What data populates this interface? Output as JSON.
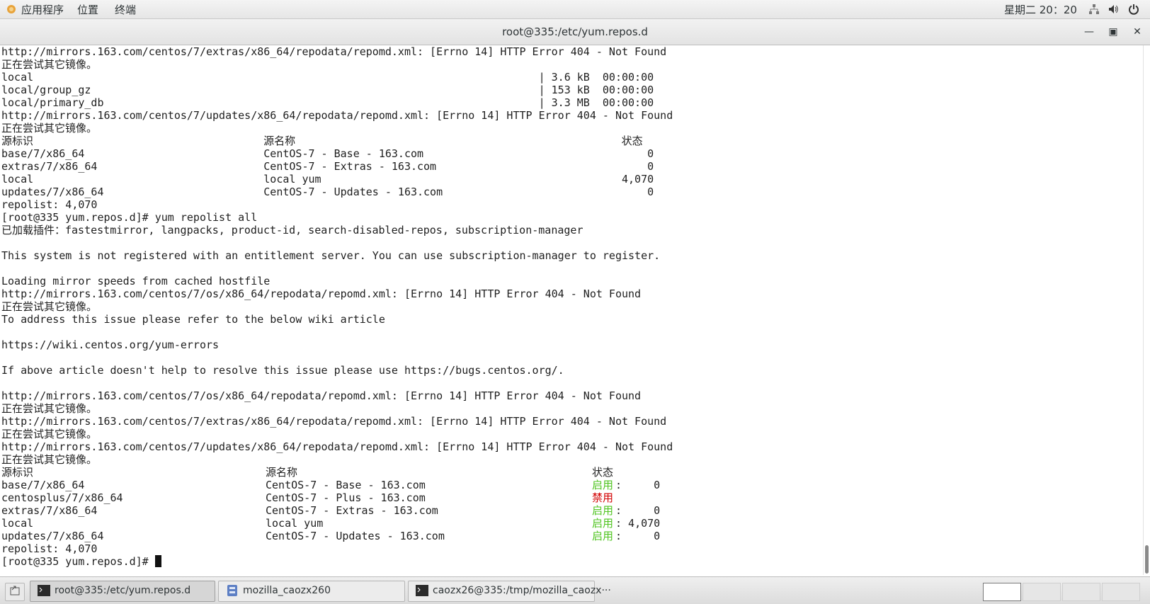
{
  "top_panel": {
    "menus": [
      "应用程序",
      "位置",
      "终端"
    ],
    "clock": "星期二 20：20",
    "icons": [
      "apps-icon",
      "network-icon",
      "volume-icon",
      "power-icon"
    ]
  },
  "window": {
    "title": "root@335:/etc/yum.repos.d",
    "buttons": [
      "minimize",
      "maximize",
      "close"
    ]
  },
  "terminal": {
    "lines": [
      "http://mirrors.163.com/centos/7/extras/x86_64/repodata/repomd.xml: [Errno 14] HTTP Error 404 - Not Found",
      "正在尝试其它镜像。",
      "local                                                                               | 3.6 kB  00:00:00",
      "local/group_gz                                                                      | 153 kB  00:00:00",
      "local/primary_db                                                                    | 3.3 MB  00:00:00",
      "http://mirrors.163.com/centos/7/updates/x86_64/repodata/repomd.xml: [Errno 14] HTTP Error 404 - Not Found",
      "正在尝试其它镜像。",
      "源标识                                    源名称                                                   状态",
      "base/7/x86_64                            CentOS-7 - Base - 163.com                                   0",
      "extras/7/x86_64                          CentOS-7 - Extras - 163.com                                 0",
      "local                                    local yum                                               4,070",
      "updates/7/x86_64                         CentOS-7 - Updates - 163.com                                0",
      "repolist: 4,070",
      "[root@335 yum.repos.d]# yum repolist all",
      "已加载插件：fastestmirror, langpacks, product-id, search-disabled-repos, subscription-manager",
      "",
      "This system is not registered with an entitlement server. You can use subscription-manager to register.",
      "",
      "Loading mirror speeds from cached hostfile",
      "http://mirrors.163.com/centos/7/os/x86_64/repodata/repomd.xml: [Errno 14] HTTP Error 404 - Not Found",
      "正在尝试其它镜像。",
      "To address this issue please refer to the below wiki article",
      "",
      "https://wiki.centos.org/yum-errors",
      "",
      "If above article doesn't help to resolve this issue please use https://bugs.centos.org/.",
      "",
      "http://mirrors.163.com/centos/7/os/x86_64/repodata/repomd.xml: [Errno 14] HTTP Error 404 - Not Found",
      "正在尝试其它镜像。",
      "http://mirrors.163.com/centos/7/extras/x86_64/repodata/repomd.xml: [Errno 14] HTTP Error 404 - Not Found",
      "正在尝试其它镜像。",
      "http://mirrors.163.com/centos/7/updates/x86_64/repodata/repomd.xml: [Errno 14] HTTP Error 404 - Not Found",
      "正在尝试其它镜像。"
    ],
    "repo_table": {
      "headers": [
        "源标识",
        "源名称",
        "状态"
      ],
      "rows": [
        {
          "id": "base/7/x86_64",
          "name": "CentOS-7 - Base - 163.com",
          "status": "启用",
          "count": "0"
        },
        {
          "id": "centosplus/7/x86_64",
          "name": "CentOS-7 - Plus - 163.com",
          "status": "禁用",
          "count": ""
        },
        {
          "id": "extras/7/x86_64",
          "name": "CentOS-7 - Extras - 163.com",
          "status": "启用",
          "count": "0"
        },
        {
          "id": "local",
          "name": "local yum",
          "status": "启用",
          "count": "4,070"
        },
        {
          "id": "updates/7/x86_64",
          "name": "CentOS-7 - Updates - 163.com",
          "status": "启用",
          "count": "0"
        }
      ]
    },
    "footer_lines": [
      "repolist: 4,070"
    ],
    "prompt": "[root@335 yum.repos.d]# ",
    "colors": {
      "enabled": "#4fc41f",
      "disabled": "#d20000"
    }
  },
  "taskbar": {
    "tasks": [
      {
        "label": "root@335:/etc/yum.repos.d",
        "icon": "terminal-icon",
        "active": true
      },
      {
        "label": "mozilla_caozx260",
        "icon": "file-manager-icon",
        "active": false
      },
      {
        "label": "caozx26@335:/tmp/mozilla_caozx···",
        "icon": "terminal-icon",
        "active": false
      }
    ],
    "workspaces": 4,
    "active_workspace": 1
  }
}
